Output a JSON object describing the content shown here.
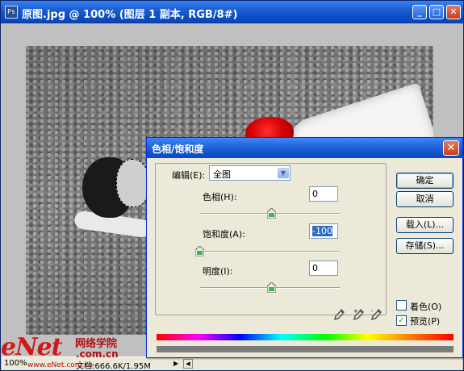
{
  "document": {
    "title": "原图.jpg @ 100% (图层 1 副本, RGB/8#)",
    "app_icon": "Ps",
    "controls": {
      "minimize": "_",
      "maximize": "□",
      "close": "✕"
    },
    "status": {
      "zoom": "100%",
      "doc_size": "文档:666.6K/1.95M",
      "arrow": "▶",
      "scroll_left": "◀"
    }
  },
  "watermark": {
    "logo": "eNet",
    "cn_text": "网络学院",
    "url": ".com.cn",
    "url_small": "www.eNet.com.cn"
  },
  "dialog": {
    "title": "色相/饱和度",
    "close": "✕",
    "edit_label": "编辑(E):",
    "edit_value": "全图",
    "hue": {
      "label": "色相(H):",
      "value": "0",
      "level": 0.5
    },
    "saturation": {
      "label": "饱和度(A):",
      "value": "-100",
      "level": 0.0
    },
    "lightness": {
      "label": "明度(I):",
      "value": "0",
      "level": 0.5
    },
    "buttons": {
      "ok": "确定",
      "cancel": "取消",
      "load": "载入(L)...",
      "save": "存储(S)..."
    },
    "colorize": {
      "label": "着色(O)",
      "checked": false
    },
    "preview": {
      "label": "预览(P)",
      "checked": true,
      "mark": "✓"
    }
  },
  "colors": {
    "titlebar": "#0b4fc7",
    "close": "#c4401f",
    "accent_red": "#d80000"
  },
  "icons": [
    "app-icon",
    "minimize-icon",
    "maximize-icon",
    "close-icon",
    "dropdown-arrow-icon",
    "slider-thumb-icon",
    "eyedropper-icon",
    "eyedropper-plus-icon",
    "eyedropper-minus-icon",
    "checkmark-icon"
  ]
}
